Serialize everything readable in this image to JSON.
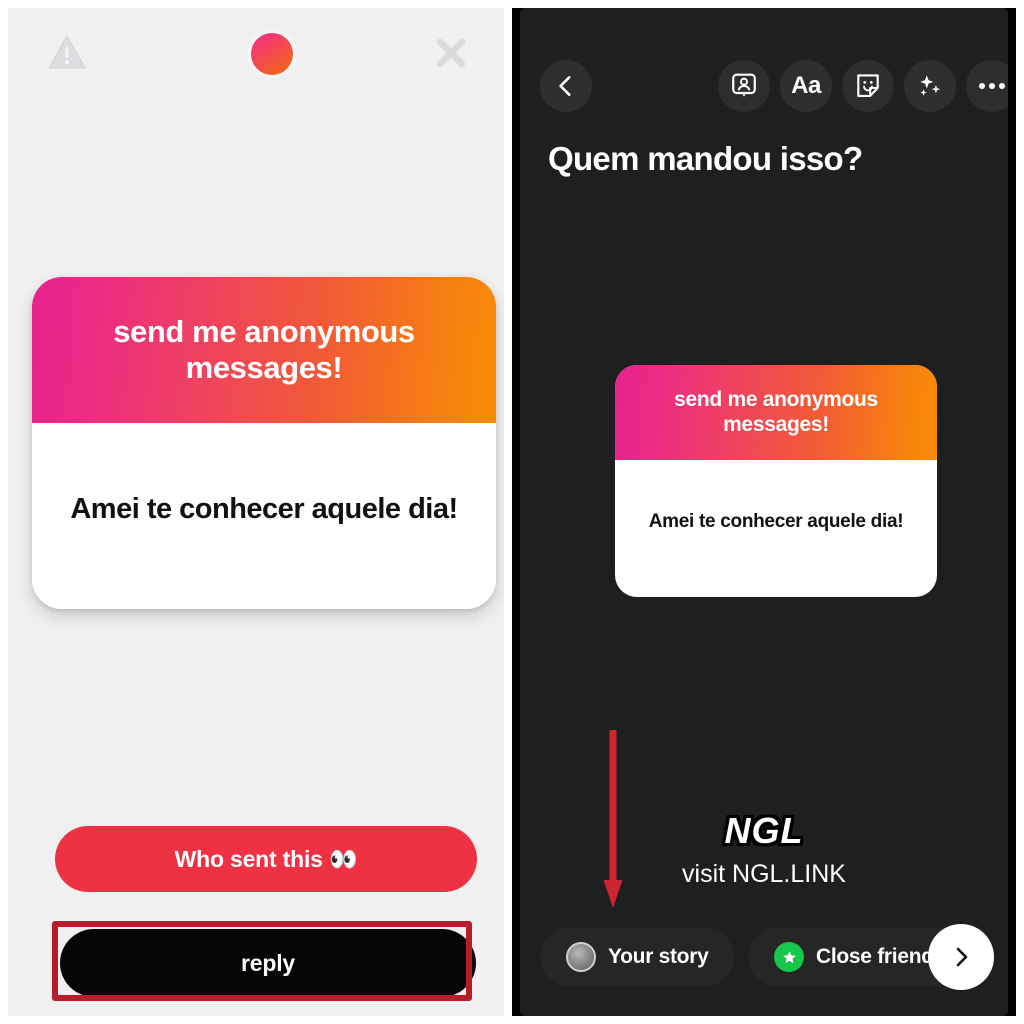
{
  "left_panel": {
    "name": "ngl-message-view",
    "topbar": {
      "warning_icon": "warning-triangle-icon",
      "brand_icon": "ngl-gradient-dot",
      "close_icon": "close-x-icon"
    },
    "card": {
      "prompt": "send me anonymous messages!",
      "message": "Amei te conhecer aquele dia!"
    },
    "actions": {
      "who_sent_this": "Who sent this 👀",
      "reply": "reply"
    },
    "annotation": {
      "type": "highlight-box",
      "color": "#b81c2a",
      "target": "reply"
    }
  },
  "right_panel": {
    "name": "instagram-story-composer",
    "toolbar": {
      "back_icon": "chevron-left-icon",
      "items": [
        {
          "icon": "tag-person-icon",
          "label": ""
        },
        {
          "icon": "text-aa-icon",
          "label": "Aa"
        },
        {
          "icon": "sticker-smiley-icon",
          "label": ""
        },
        {
          "icon": "sparkles-icon",
          "label": ""
        },
        {
          "icon": "more-dots-icon",
          "label": ""
        }
      ]
    },
    "title": "Quem mandou isso?",
    "card": {
      "prompt": "send me anonymous messages!",
      "message": "Amei te conhecer aquele dia!"
    },
    "branding": {
      "logo": "NGL",
      "visit": "visit NGL.LINK"
    },
    "annotation": {
      "type": "down-arrow",
      "color": "#cc2430",
      "target": "your-story-chip"
    },
    "bottom_bar": {
      "your_story": "Your story",
      "close_friends": "Close friends",
      "send_icon": "chevron-right-icon",
      "close_friends_color": "#18c64b"
    }
  },
  "colors": {
    "gradient_start": "#e8228e",
    "gradient_end": "#f88c06",
    "cta_red": "#ee3244",
    "annotation_red": "#b81c2a",
    "panel_bg": "#f0f0f0",
    "story_bg": "#1f1f1f"
  }
}
